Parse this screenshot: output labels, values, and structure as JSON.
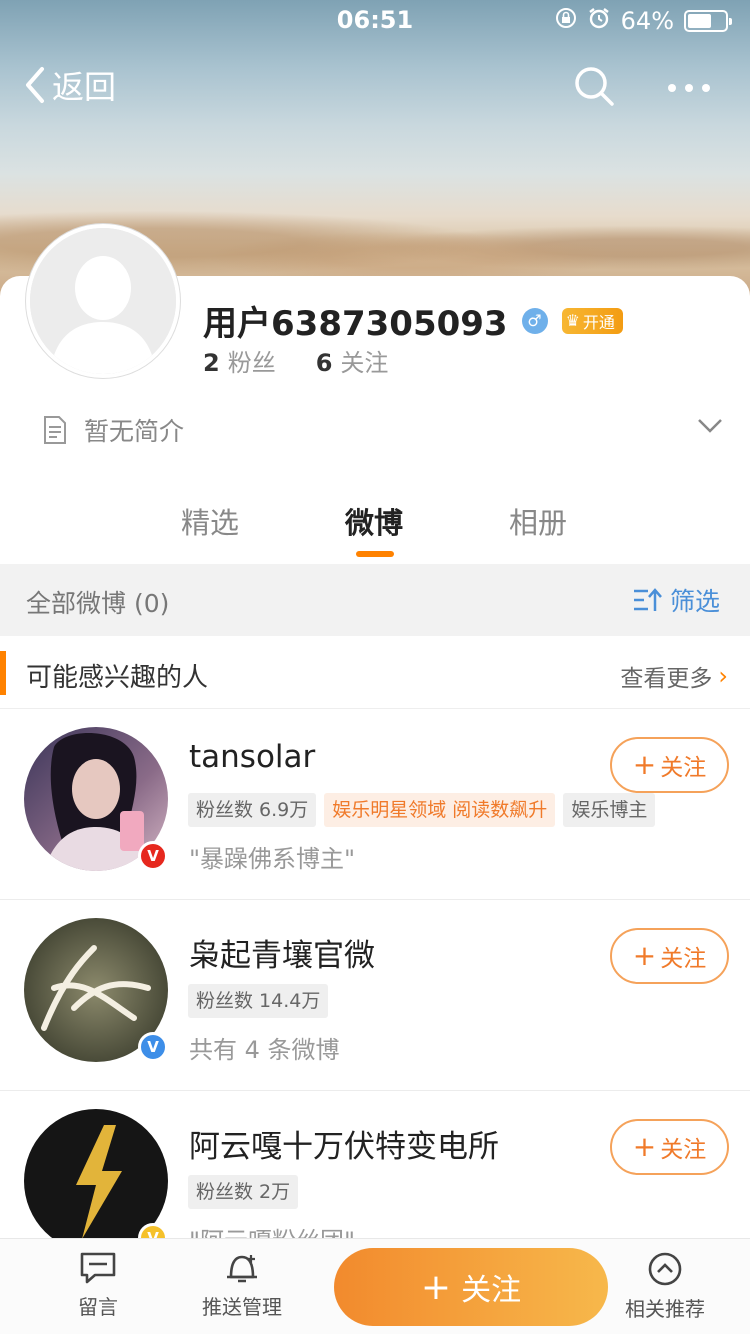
{
  "status_bar": {
    "time": "06:51",
    "battery": "64%",
    "battery_level": 0.64
  },
  "nav": {
    "back_label": "返回"
  },
  "profile": {
    "name": "用户6387305093",
    "gender_icon": "male-icon",
    "vip_label": "开通",
    "fans_count": "2",
    "fans_label": "粉丝",
    "following_count": "6",
    "following_label": "关注",
    "intro": "暂无简介"
  },
  "tabs": [
    {
      "label": "精选",
      "active": false
    },
    {
      "label": "微博",
      "active": true
    },
    {
      "label": "相册",
      "active": false
    }
  ],
  "filter_bar": {
    "summary": "全部微博 (0)",
    "filter_label": "筛选"
  },
  "recommend": {
    "title": "可能感兴趣的人",
    "more_label": "查看更多",
    "people": [
      {
        "name": "tansolar",
        "tags": [
          "粉丝数 6.9万",
          "娱乐明星领域 阅读数飙升",
          "娱乐博主"
        ],
        "desc": "\"暴躁佛系博主\"",
        "badge": "V",
        "badge_color": "#e6281e",
        "follow_label": "关注"
      },
      {
        "name": "枭起青壤官微",
        "tags": [
          "粉丝数 14.4万"
        ],
        "desc": "共有 4 条微博",
        "badge": "V",
        "badge_color": "#3d8ee8",
        "follow_label": "关注"
      },
      {
        "name": "阿云嘎十万伏特变电所",
        "tags": [
          "粉丝数 2万"
        ],
        "desc": "\"阿云嘎粉丝团\"",
        "badge": "V",
        "badge_color": "#f5c12b",
        "follow_label": "关注"
      }
    ]
  },
  "bottom_bar": {
    "comment_label": "留言",
    "push_label": "推送管理",
    "follow_label": "关注",
    "related_label": "相关推荐"
  },
  "colors": {
    "accent": "#ff8200",
    "link": "#4a8fd8"
  }
}
